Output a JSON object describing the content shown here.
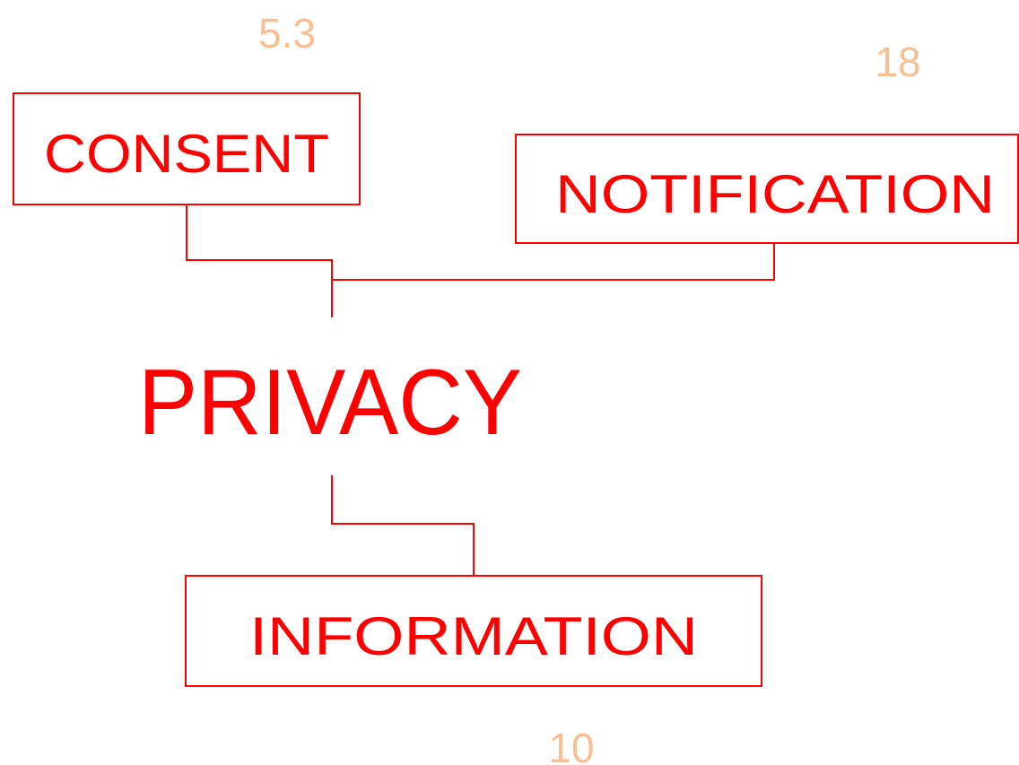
{
  "diagram": {
    "center": {
      "label": "PRIVACY"
    },
    "nodes": [
      {
        "id": "consent",
        "label": "CONSENT",
        "value": "5.3"
      },
      {
        "id": "notification",
        "label": "NOTIFICATION",
        "value": "18"
      },
      {
        "id": "information",
        "label": "INFORMATION",
        "value": "10"
      }
    ]
  },
  "colors": {
    "line": "#ff0000",
    "label": "#ff0000",
    "value": "#f8bf93"
  }
}
